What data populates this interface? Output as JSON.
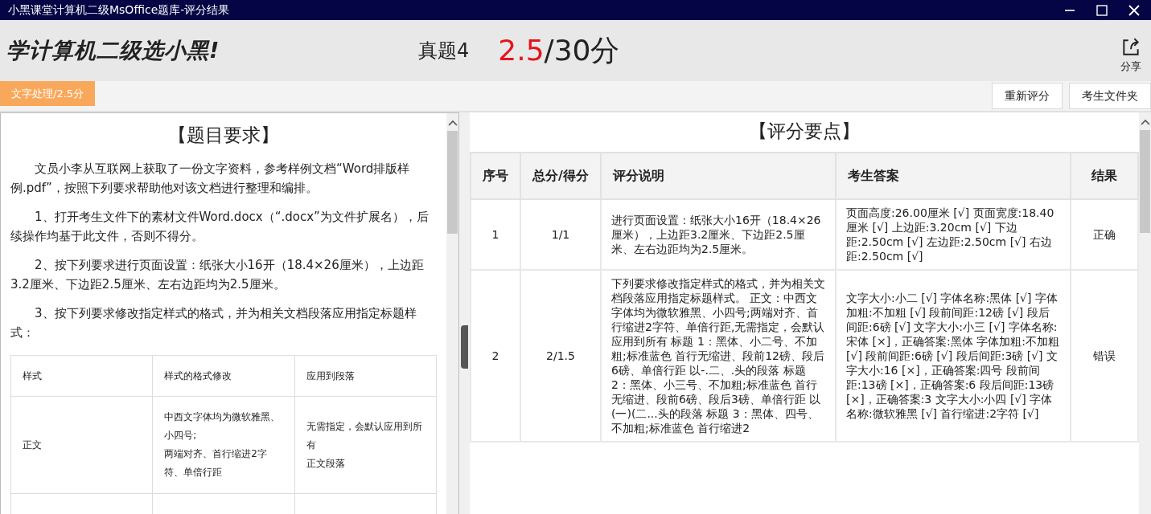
{
  "window": {
    "title": "小黑课堂计算机二级MsOffice题库-评分结果"
  },
  "header": {
    "slogan": "学计算机二级选小黑!",
    "exam": "真题4",
    "score": "2.5",
    "total": "/30分",
    "share": "分享"
  },
  "tabs": [
    {
      "label": "文字处理/2.5分",
      "selected": true
    }
  ],
  "actions": [
    "重新评分",
    "考生文件夹"
  ],
  "question": {
    "title": "【题目要求】",
    "paragraphs": [
      "文员小李从互联网上获取了一份文字资料，参考样例文档“Word排版样例.pdf”，按照下列要求帮助他对该文档进行整理和编排。",
      "1、打开考生文件下的素材文件Word.docx（“.docx”为文件扩展名），后续操作均基于此文件，否则不得分。",
      "2、按下列要求进行页面设置：纸张大小16开（18.4×26厘米），上边距3.2厘米、下边距2.5厘米、左右边距均为2.5厘米。",
      "3、按下列要求修改指定样式的格式，并为相关文档段落应用指定标题样式："
    ],
    "table": {
      "columns": [
        "样式",
        "样式的格式修改",
        "应用到段落"
      ],
      "rows": [
        [
          [
            "正文"
          ],
          [
            "中西文字体均为微软雅黑、小四号;",
            "两端对齐、首行缩进2字符、单倍行距"
          ],
          [
            "无需指定，会默认应用到所有",
            "正文段落"
          ]
        ]
      ]
    }
  },
  "grading": {
    "title": "【评分要点】",
    "columns": [
      "序号",
      "总分/得分",
      "评分说明",
      "考生答案",
      "结果"
    ],
    "rows": [
      [
        "1",
        "1/1",
        "进行页面设置：纸张大小16开（18.4×26厘米），上边距3.2厘米、下边距2.5厘米、左右边距均为2.5厘米。",
        "页面高度:26.00厘米 [√] 页面宽度:18.40厘米 [√] 上边距:3.20cm [√] 下边距:2.50cm [√] 左边距:2.50cm [√] 右边距:2.50cm [√]",
        "正确"
      ],
      [
        "2",
        "2/1.5",
        "下列要求修改指定样式的格式，并为相关文档段落应用指定标题样式。 正文：中西文字体均为微软雅黑、小四号;两端对齐、首行缩进2字符、单倍行距,无需指定，会默认应用到所有 标题 1：黑体、小二号、不加粗;标准蓝色 首行无缩进、段前12磅、段后6磅、单倍行距 以-.二、.头的段落 标题 2：黑体、小三号、不加粗;标准蓝色 首行无缩进、段前6磅、段后3磅、单倍行距 以(一)(二...头的段落 标题 3：黑体、四号、不加粗;标准蓝色 首行缩进2",
        "文字大小:小二 [√] 字体名称:黑体 [√] 字体加粗:不加粗 [√] 段前间距:12磅 [√] 段后间距:6磅 [√] 文字大小:小三 [√] 字体名称:宋体 [×]，正确答案:黑体 字体加粗:不加粗 [√] 段前间距:6磅 [√] 段后间距:3磅 [√] 文字大小:16 [×]，正确答案:四号 段前间距:13磅 [×]，正确答案:6 段后间距:13磅 [×]，正确答案:3 文字大小:小四 [√] 字体名称:微软雅黑 [√] 首行缩进:2字符 [√]",
        "错误"
      ]
    ]
  }
}
